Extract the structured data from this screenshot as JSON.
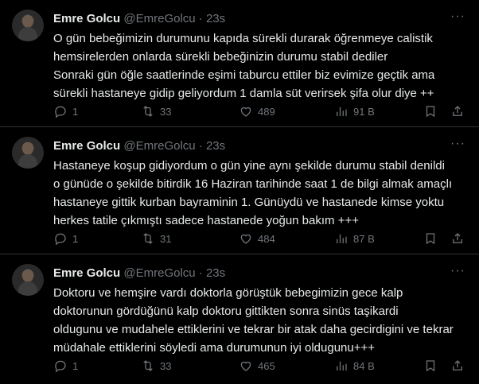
{
  "tweets": [
    {
      "name": "Emre Golcu",
      "handle": "@EmreGolcu",
      "dot": "·",
      "time": "23s",
      "text": "O gün bebeğimizin durumunu kapıda sürekli durarak öğrenmeye calistik\nhemsirelerden onlarda sürekli bebeğinizin durumu stabil dediler\nSonraki gün öğle saatlerinde eşimi taburcu ettiler biz evimize geçtik ama\nsürekli hastaneye gidip geliyordum 1 damla süt verirsek şifa olur diye ++",
      "replies": "1",
      "retweets": "33",
      "likes": "489",
      "views": "91 B"
    },
    {
      "name": "Emre Golcu",
      "handle": "@EmreGolcu",
      "dot": "·",
      "time": "23s",
      "text": "Hastaneye koşup gidiyordum o gün yine aynı şekilde durumu stabil denildi\no günüde o şekilde bitirdik 16 Haziran tarihinde saat 1 de bilgi almak amaçlı\nhastaneye gittik kurban bayraminin 1. Günüydü ve hastanede kimse yoktu\nherkes tatile çıkmıştı sadece hastanede yoğun bakım +++",
      "replies": "1",
      "retweets": "31",
      "likes": "484",
      "views": "87 B"
    },
    {
      "name": "Emre Golcu",
      "handle": "@EmreGolcu",
      "dot": "·",
      "time": "23s",
      "text": "Doktoru ve hemşire vardı doktorla görüştük bebegimizin gece kalp\ndoktorunun gördüğünü kalp doktoru gittikten sonra sinüs taşikardi\noldugunu ve mudahele ettiklerini ve tekrar bir atak daha gecirdigini ve tekrar\nmüdahale ettiklerini söyledi ama durumunun iyi oldugunu+++",
      "replies": "1",
      "retweets": "33",
      "likes": "465",
      "views": "84 B"
    }
  ]
}
